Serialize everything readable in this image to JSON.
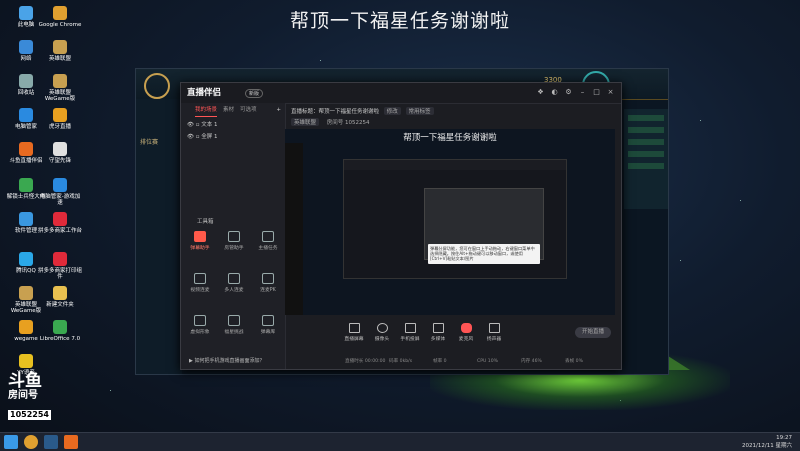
{
  "banner_title": "帮顶一下福星任务谢谢啦",
  "desktop_icons": [
    {
      "label": "此电脑",
      "color": "#4aa3e8"
    },
    {
      "label": "Google Chrome",
      "color": "#e0a030"
    },
    {
      "label": "网络",
      "color": "#3a8ad8"
    },
    {
      "label": "英雄联盟",
      "color": "#c8a050"
    },
    {
      "label": "回收站",
      "color": "#8aa"
    },
    {
      "label": "英雄联盟 WeGame版",
      "color": "#c8a050"
    },
    {
      "label": "电脑管家",
      "color": "#2a8ae0"
    },
    {
      "label": "虎牙直播",
      "color": "#e8a020"
    },
    {
      "label": "斗鱼直播伴侣",
      "color": "#e86a20"
    },
    {
      "label": "守望先锋",
      "color": "#e0e0e0"
    },
    {
      "label": "解锁士兵怪大师",
      "color": "#3aa850"
    },
    {
      "label": "电脑管家-游戏加速",
      "color": "#2a8ae0"
    },
    {
      "label": "软件管理",
      "color": "#3a98e0"
    },
    {
      "label": "拼多多商家工作台",
      "color": "#e02a3a"
    },
    {
      "label": "腾讯QQ",
      "color": "#2aa8e8"
    },
    {
      "label": "拼多多商家打印组件",
      "color": "#e02a3a"
    },
    {
      "label": "英雄联盟 WeGame版",
      "color": "#c8a050"
    },
    {
      "label": "新建文件夹",
      "color": "#e8c050"
    },
    {
      "label": "wegame",
      "color": "#e8a020"
    },
    {
      "label": "LibreOffice 7.0",
      "color": "#3aa850"
    },
    {
      "label": "YY语音",
      "color": "#e8c020"
    }
  ],
  "douyu": {
    "brand": "斗鱼",
    "sub": "房间号",
    "room": "1052254"
  },
  "game_window": {
    "side_label": "排位赛",
    "currency": "3300"
  },
  "live_window": {
    "logo": "直播伴侣",
    "badge": "新版",
    "left_tabs": [
      "我的场景",
      "素材",
      "可选项"
    ],
    "scenes": [
      "文本 1",
      "全屏 1"
    ],
    "tools_title": "工具箱",
    "tools": [
      {
        "label": "弹幕助手",
        "red": true
      },
      {
        "label": "房管助手",
        "red": false
      },
      {
        "label": "主播任务",
        "red": false
      },
      {
        "label": "视频连麦",
        "red": false
      },
      {
        "label": "多人连麦",
        "red": false
      },
      {
        "label": "连麦PK",
        "red": false
      },
      {
        "label": "虚拟形象",
        "red": false
      },
      {
        "label": "福星挑战",
        "red": false
      },
      {
        "label": "弹幕库",
        "red": false
      }
    ],
    "room_title_prefix": "直播标题：",
    "room_title": "帮顶一下福星任务谢谢啦",
    "room_pills": [
      "修改",
      "常用标签"
    ],
    "category": "英雄联盟",
    "room_id_label": "房间号",
    "room_id": "1052254",
    "preview_title": "帮顶一下福星任务谢谢啦",
    "tip_text": "弹幕分屏功能，您可在窗口上手动拖动，右键窗口菜单中选择隐藏。按住Alt+拖动键可以移动窗口，或使用[Ctrl+V]粘贴文本/图片",
    "bottom_buttons": [
      "直播屏幕",
      "摄像头",
      "手机投屏",
      "多媒体",
      "麦克风",
      "扬声器"
    ],
    "start_label": "开始直播",
    "status_items": [
      "直播时长 00:00:00",
      "码率 0kb/s",
      "帧率 0",
      "CPU 10%",
      "内存 46%",
      "丢帧 0%"
    ],
    "notice": "如何把手机游戏直播画面添加？"
  },
  "clock": {
    "time": "19:27",
    "date": "2021/12/11 星期六"
  }
}
